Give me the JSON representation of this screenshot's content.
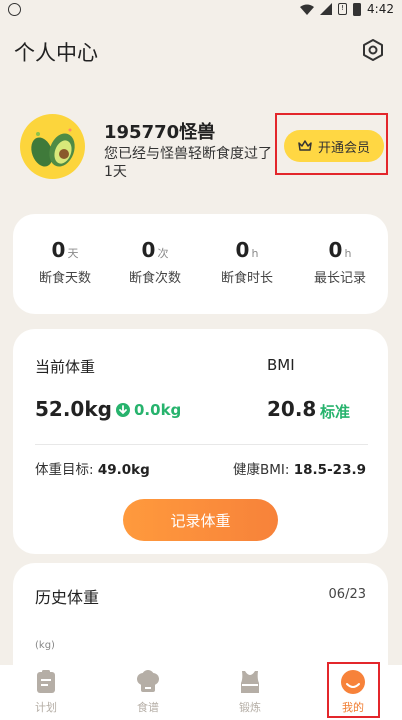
{
  "status_bar": {
    "time": "4:42"
  },
  "header": {
    "title": "个人中心",
    "settings_icon": "gear-hexagon-icon"
  },
  "profile": {
    "username": "195770怪兽",
    "subtitle": "您已经与怪兽轻断食度过了1天",
    "vip_label": "开通会员",
    "vip_icon": "crown-icon"
  },
  "stats": [
    {
      "value": "0",
      "unit": "天",
      "label": "断食天数"
    },
    {
      "value": "0",
      "unit": "次",
      "label": "断食次数"
    },
    {
      "value": "0",
      "unit": "h",
      "label": "断食时长"
    },
    {
      "value": "0",
      "unit": "h",
      "label": "最长记录"
    }
  ],
  "weight": {
    "current_label": "当前体重",
    "current_value": "52.0kg",
    "delta": "0.0kg",
    "bmi_label": "BMI",
    "bmi_value": "20.8",
    "bmi_status": "标准",
    "target_label": "体重目标:",
    "target_value": "49.0kg",
    "healthy_bmi_label": "健康BMI:",
    "healthy_bmi_value": "18.5-23.9",
    "record_button": "记录体重"
  },
  "history": {
    "title": "历史体重",
    "date": "06/23",
    "unit": "(kg)"
  },
  "tabs": [
    {
      "label": "计划",
      "icon": "clipboard-icon"
    },
    {
      "label": "食谱",
      "icon": "chef-hat-icon"
    },
    {
      "label": "锻炼",
      "icon": "sports-top-icon"
    },
    {
      "label": "我的",
      "icon": "profile-face-icon",
      "active": true
    }
  ],
  "colors": {
    "background": "#f3efe9",
    "accent_orange": "#f7823a",
    "vip_yellow": "#ffd743",
    "green": "#27b36d",
    "highlight_red": "#e3262b"
  }
}
